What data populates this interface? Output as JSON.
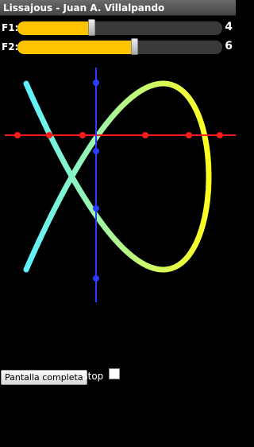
{
  "window": {
    "title": "Lissajous - Juan A. Villalpando"
  },
  "sliders": [
    {
      "label": "F1:",
      "value": "4",
      "fraction": 0.36
    },
    {
      "label": "F2:",
      "value": "6",
      "fraction": 0.57
    }
  ],
  "controls": {
    "fullscreen_label": "Pantalla completa",
    "stop_label": "Stop"
  },
  "colors": {
    "slider_fill": "#ffc400",
    "h_line": "#ff1a1a",
    "v_line": "#2a3cff",
    "curve_start": "#5ff0ff",
    "curve_end": "#ffff20"
  }
}
